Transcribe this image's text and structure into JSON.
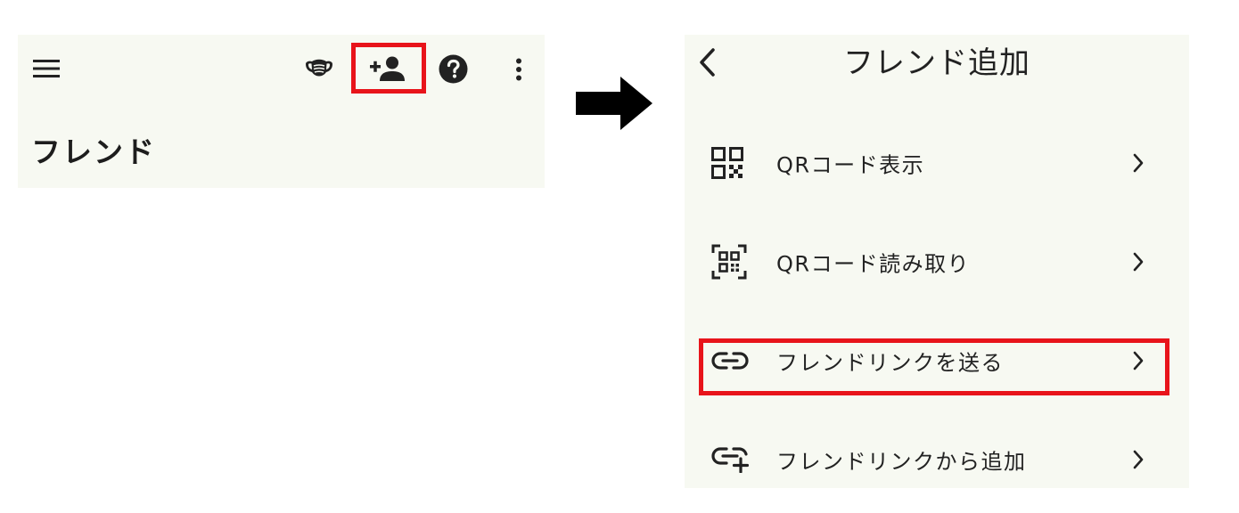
{
  "left_screen": {
    "icons": [
      "menu-icon",
      "mask-icon",
      "add-friend-icon",
      "help-icon",
      "more-vert-icon"
    ],
    "page_title": "フレンド"
  },
  "arrow_icon": "right-arrow-icon",
  "right_screen": {
    "header": {
      "back_icon": "chevron-left-icon",
      "title": "フレンド追加"
    },
    "menu": [
      {
        "label": "QRコード表示",
        "icon": "qr-code-icon"
      },
      {
        "label": "QRコード読み取り",
        "icon": "qr-scan-icon"
      },
      {
        "label": "フレンドリンクを送る",
        "icon": "link-icon"
      },
      {
        "label": "フレンドリンクから追加",
        "icon": "add-link-icon"
      }
    ]
  },
  "colors": {
    "screen_background": "#f7f9f2",
    "highlight": "#e8141b",
    "icon": "#222222"
  }
}
